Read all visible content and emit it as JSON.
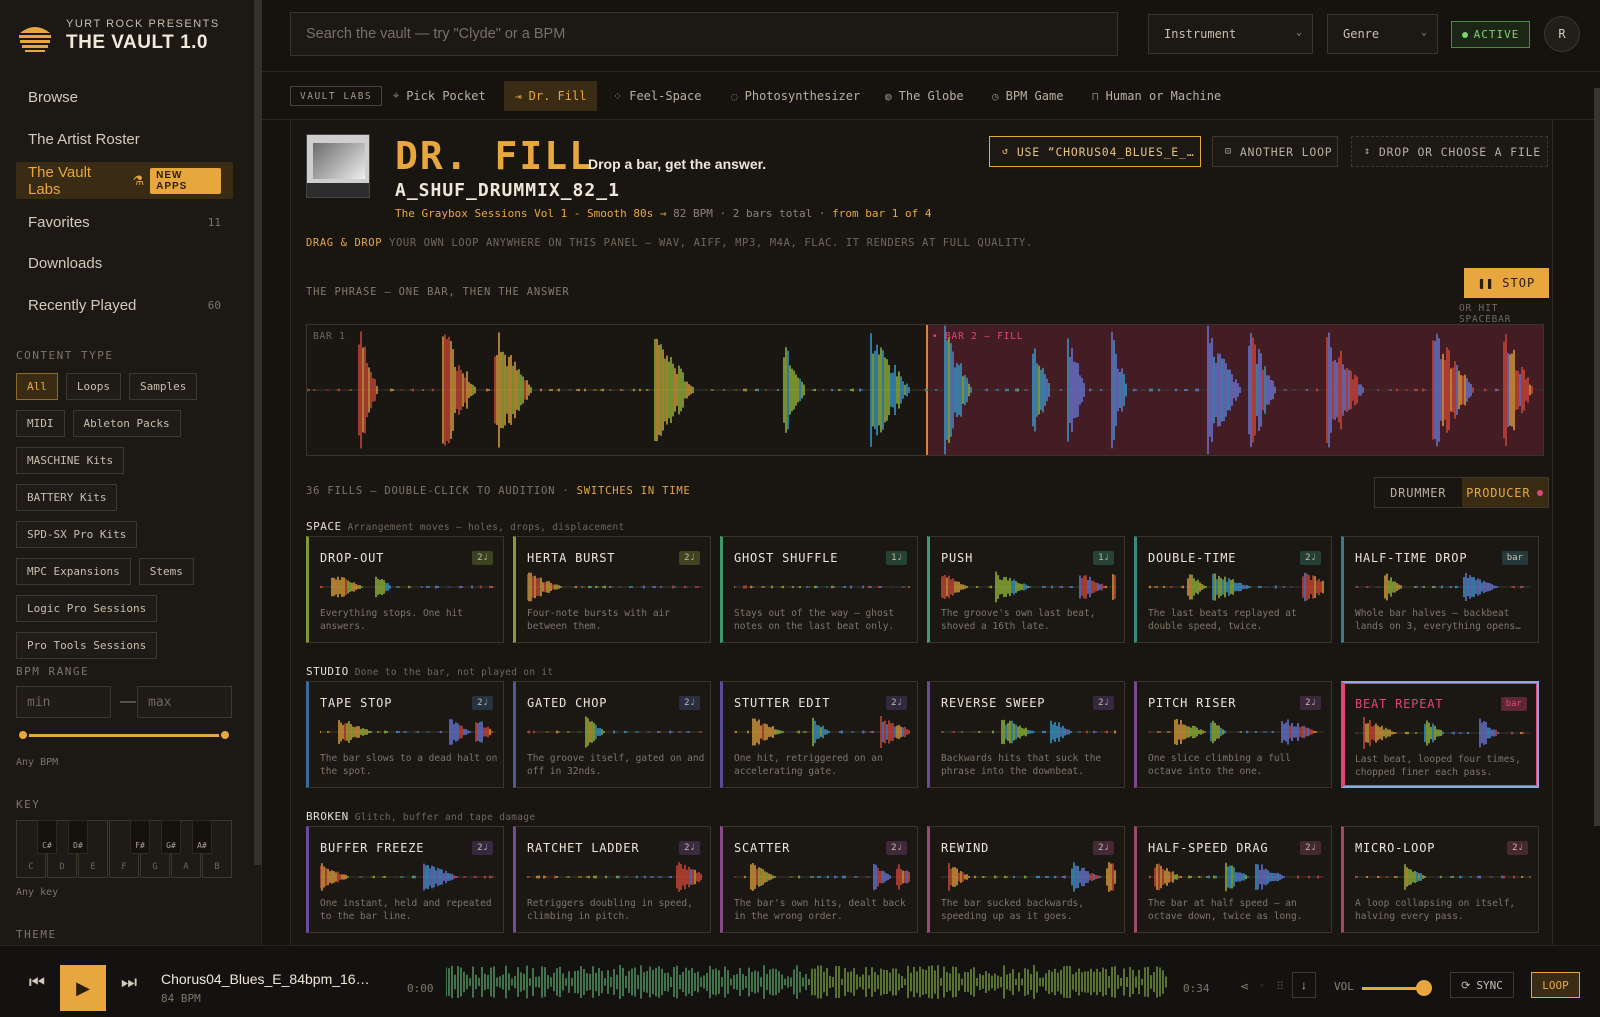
{
  "brand": {
    "presents": "YURT ROCK PRESENTS",
    "title": "THE VAULT 1.0",
    "accent": "#e8a73e"
  },
  "nav": [
    {
      "label": "Browse",
      "count": ""
    },
    {
      "label": "The Artist Roster",
      "count": ""
    },
    {
      "label": "The Vault Labs",
      "count": "",
      "badge": "NEW APPS",
      "active": true
    },
    {
      "label": "Favorites",
      "count": "11"
    },
    {
      "label": "Downloads",
      "count": ""
    },
    {
      "label": "Recently Played",
      "count": "60"
    }
  ],
  "content_type": {
    "label": "CONTENT TYPE",
    "chips": [
      "All",
      "Loops",
      "Samples",
      "MIDI",
      "Ableton Packs",
      "MASCHINE Kits",
      "BATTERY Kits",
      "SPD-SX Pro Kits",
      "MPC Expansions",
      "Stems",
      "Logic Pro Sessions",
      "Pro Tools Sessions"
    ],
    "selected": "All"
  },
  "bpm_range": {
    "label": "BPM RANGE",
    "min_placeholder": "min",
    "max_placeholder": "max",
    "dash": "—",
    "note": "Any BPM"
  },
  "key": {
    "label": "KEY",
    "white": [
      "C",
      "D",
      "E",
      "F",
      "G",
      "A",
      "B"
    ],
    "black": [
      "C#",
      "D#",
      "F#",
      "G#",
      "A#"
    ],
    "note": "Any key"
  },
  "theme_label": "THEME",
  "search": {
    "placeholder": "Search the vault — try \"Clyde\" or a BPM"
  },
  "filters": {
    "instrument": "Instrument",
    "genre": "Genre"
  },
  "status": {
    "label": "ACTIVE",
    "color": "#7fd16a"
  },
  "user": {
    "initial": "R"
  },
  "labs": {
    "tag": "VAULT LABS",
    "tabs": [
      {
        "label": "Pick Pocket",
        "icon": "pickpocket-icon",
        "glyph": "⌖"
      },
      {
        "label": "Dr. Fill",
        "icon": "fill-icon",
        "glyph": "⇥",
        "active": true
      },
      {
        "label": "Feel-Space",
        "icon": "feel-space-icon",
        "glyph": "⁘"
      },
      {
        "label": "Photosynthesizer",
        "icon": "leaf-icon",
        "glyph": "◌"
      },
      {
        "label": "The Globe",
        "icon": "globe-icon",
        "glyph": "◍"
      },
      {
        "label": "BPM Game",
        "icon": "metronome-icon",
        "glyph": "◷"
      },
      {
        "label": "Human or Machine",
        "icon": "lock-icon",
        "glyph": "⊓"
      }
    ]
  },
  "drfill": {
    "title": "DR. FILL",
    "tagline": "Drop a bar, get the answer.",
    "loop_name": "A_SHUF_DRUMMIX_82_1",
    "collection": "The Graybox Sessions Vol 1 - Smooth 80s",
    "arrow": "→",
    "bpm": "82 BPM",
    "sep": "·",
    "bars": "2 bars total",
    "from_bar": "from bar 1 of 4",
    "buttons": {
      "use": "USE “CHORUS04_BLUES_E_…",
      "another": "ANOTHER LOOP",
      "drop": "DROP OR CHOOSE A FILE"
    },
    "drop_hint_strong": "DRAG & DROP",
    "drop_hint": "YOUR OWN LOOP ANYWHERE ON THIS PANEL — WAV, AIFF, MP3, M4A, FLAC. IT RENDERS AT FULL QUALITY.",
    "phrase_label": "THE PHRASE — ONE BAR, THEN THE ANSWER",
    "stop_label": "STOP",
    "stop_note": "OR HIT SPACEBAR",
    "bar1_label": "BAR 1",
    "bar2_label": "• BAR 2 — FILL",
    "fills_count": "36 FILLS — DOUBLE-CLICK TO AUDITION",
    "fills_sep": "·",
    "fills_switch": "SWITCHES IN TIME",
    "mode": {
      "drummer": "DRUMMER",
      "producer": "PRODUCER",
      "selected": "PRODUCER"
    }
  },
  "groups": [
    {
      "name": "SPACE",
      "sub": "Arrangement moves — holes, drops, displacement",
      "cards": [
        {
          "title": "DROP-OUT",
          "badge": "2♩",
          "desc": "Everything stops. One hit answers.",
          "color": "#7a9a3a"
        },
        {
          "title": "HERTA BURST",
          "badge": "2♩",
          "desc": "Four-note bursts with air between them.",
          "color": "#8a9a3a"
        },
        {
          "title": "GHOST SHUFFLE",
          "badge": "1♩",
          "desc": "Stays out of the way — ghost notes on the last beat only.",
          "color": "#3a9a6a"
        },
        {
          "title": "PUSH",
          "badge": "1♩",
          "desc": "The groove's own last beat, shoved a 16th late.",
          "color": "#3a9a7a"
        },
        {
          "title": "DOUBLE-TIME",
          "badge": "2♩",
          "desc": "The last beats replayed at double speed, twice.",
          "color": "#3a8a7a"
        },
        {
          "title": "HALF-TIME DROP",
          "badge": "bar",
          "desc": "Whole bar halves — backbeat lands on 3, everything opens…",
          "color": "#3a7a8a"
        }
      ]
    },
    {
      "name": "STUDIO",
      "sub": "Done to the bar, not played on it",
      "cards": [
        {
          "title": "TAPE STOP",
          "badge": "2♩",
          "desc": "The bar slows to a dead halt on the spot.",
          "color": "#3a6a9a"
        },
        {
          "title": "GATED CHOP",
          "badge": "2♩",
          "desc": "The groove itself, gated on and off in 32nds.",
          "color": "#4a5a9a"
        },
        {
          "title": "STUTTER EDIT",
          "badge": "2♩",
          "desc": "One hit, retriggered on an accelerating gate.",
          "color": "#5a4a9a"
        },
        {
          "title": "REVERSE SWEEP",
          "badge": "2♩",
          "desc": "Backwards hits that suck the phrase into the downbeat.",
          "color": "#6a4a9a"
        },
        {
          "title": "PITCH RISER",
          "badge": "2♩",
          "desc": "One slice climbing a full octave into the one.",
          "color": "#7a4a8a"
        },
        {
          "title": "BEAT REPEAT",
          "badge": "bar",
          "desc": "Last beat, looped four times, chopped finer each pass.",
          "color": "#e0457a",
          "selected": true
        }
      ]
    },
    {
      "name": "BROKEN",
      "sub": "Glitch, buffer and tape damage",
      "cards": [
        {
          "title": "BUFFER FREEZE",
          "badge": "2♩",
          "desc": "One instant, held and repeated to the bar line.",
          "color": "#6a4a9a"
        },
        {
          "title": "RATCHET LADDER",
          "badge": "2♩",
          "desc": "Retriggers doubling in speed, climbing in pitch.",
          "color": "#7a4a9a"
        },
        {
          "title": "SCATTER",
          "badge": "2♩",
          "desc": "The bar's own hits, dealt back in the wrong order.",
          "color": "#8a4a8a"
        },
        {
          "title": "REWIND",
          "badge": "2♩",
          "desc": "The bar sucked backwards, speeding up as it goes.",
          "color": "#9a4a7a"
        },
        {
          "title": "HALF-SPEED DRAG",
          "badge": "2♩",
          "desc": "The bar at half speed — an octave down, twice as long.",
          "color": "#9a4a6a"
        },
        {
          "title": "MICRO-LOOP",
          "badge": "2♩",
          "desc": "A loop collapsing on itself, halving every pass.",
          "color": "#a04a5a"
        }
      ]
    }
  ],
  "player": {
    "track": "Chorus04_Blues_E_84bpm_16…",
    "bpm": "84 BPM",
    "time_current": "0:00",
    "time_total": "0:34",
    "vol_label": "VOL",
    "volume": 0.85,
    "sync_label": "SYNC",
    "loop_label": "LOOP"
  }
}
